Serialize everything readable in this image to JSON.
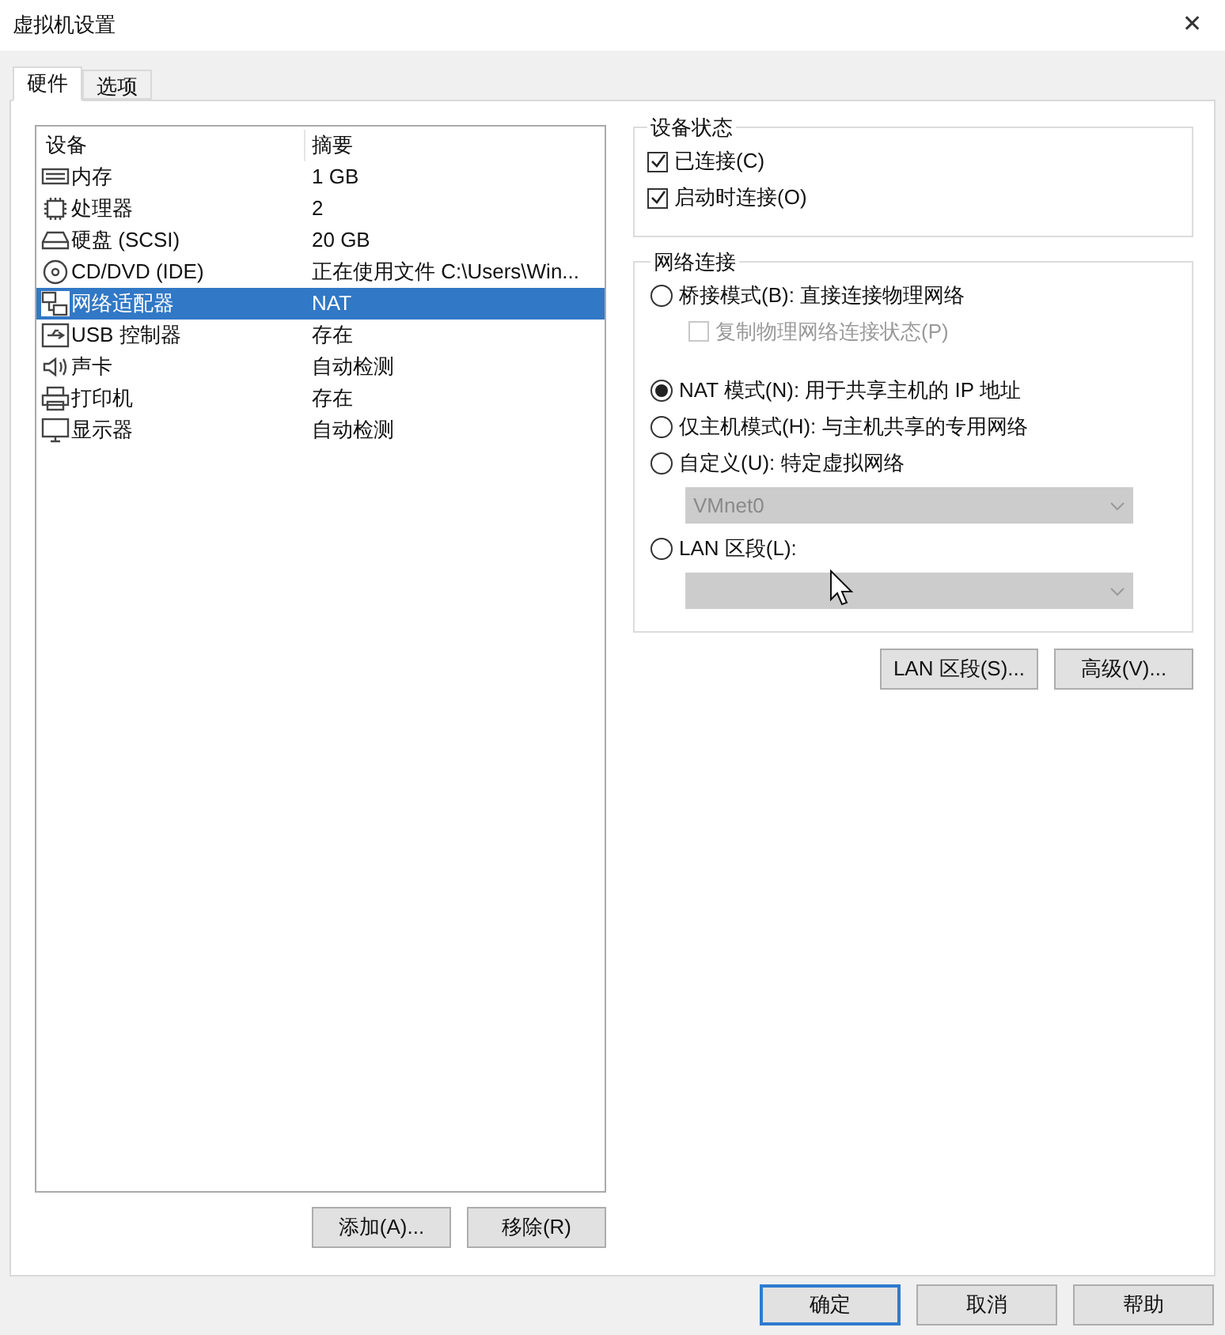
{
  "window": {
    "title": "虚拟机设置",
    "close": "✕"
  },
  "tabs": [
    {
      "label": "硬件",
      "selected": true
    },
    {
      "label": "选项",
      "selected": false
    }
  ],
  "device_table": {
    "columns": [
      "设备",
      "摘要"
    ],
    "rows": [
      {
        "kind": "memory",
        "device": "内存",
        "summary": "1 GB",
        "selected": false
      },
      {
        "kind": "cpu",
        "device": "处理器",
        "summary": "2",
        "selected": false
      },
      {
        "kind": "disk",
        "device": "硬盘 (SCSI)",
        "summary": "20 GB",
        "selected": false
      },
      {
        "kind": "cd",
        "device": "CD/DVD (IDE)",
        "summary": "正在使用文件 C:\\Users\\Win...",
        "selected": false
      },
      {
        "kind": "network",
        "device": "网络适配器",
        "summary": "NAT",
        "selected": true
      },
      {
        "kind": "usb",
        "device": "USB 控制器",
        "summary": "存在",
        "selected": false
      },
      {
        "kind": "sound",
        "device": "声卡",
        "summary": "自动检测",
        "selected": false
      },
      {
        "kind": "printer",
        "device": "打印机",
        "summary": "存在",
        "selected": false
      },
      {
        "kind": "display",
        "device": "显示器",
        "summary": "自动检测",
        "selected": false
      }
    ]
  },
  "list_buttons": [
    "添加(A)...",
    "移除(R)"
  ],
  "device_status": {
    "title": "设备状态",
    "items": [
      {
        "label": "已连接(C)",
        "checked": true
      },
      {
        "label": "启动时连接(O)",
        "checked": true
      }
    ]
  },
  "network_connection": {
    "title": "网络连接",
    "items": [
      {
        "kind": "radio",
        "label": "桥接模式(B): 直接连接物理网络",
        "selected": false
      },
      {
        "kind": "checkbox",
        "label": "复制物理网络连接状态(P)",
        "checked": false,
        "disabled": true
      },
      {
        "kind": "radio",
        "label": "NAT 模式(N): 用于共享主机的 IP 地址",
        "selected": true
      },
      {
        "kind": "radio",
        "label": "仅主机模式(H): 与主机共享的专用网络",
        "selected": false
      },
      {
        "kind": "radio",
        "label": "自定义(U): 特定虚拟网络",
        "selected": false
      },
      {
        "kind": "dropdown",
        "value": "VMnet0",
        "disabled": true
      },
      {
        "kind": "radio",
        "label": "LAN 区段(L):",
        "selected": false
      },
      {
        "kind": "dropdown",
        "disabled": true
      }
    ]
  },
  "network_buttons": [
    "LAN 区段(S)...",
    "高级(V)..."
  ],
  "dialog_buttons": [
    {
      "label": "确定",
      "default": true
    },
    {
      "label": "取消",
      "default": false
    },
    {
      "label": "帮助",
      "default": false
    }
  ]
}
